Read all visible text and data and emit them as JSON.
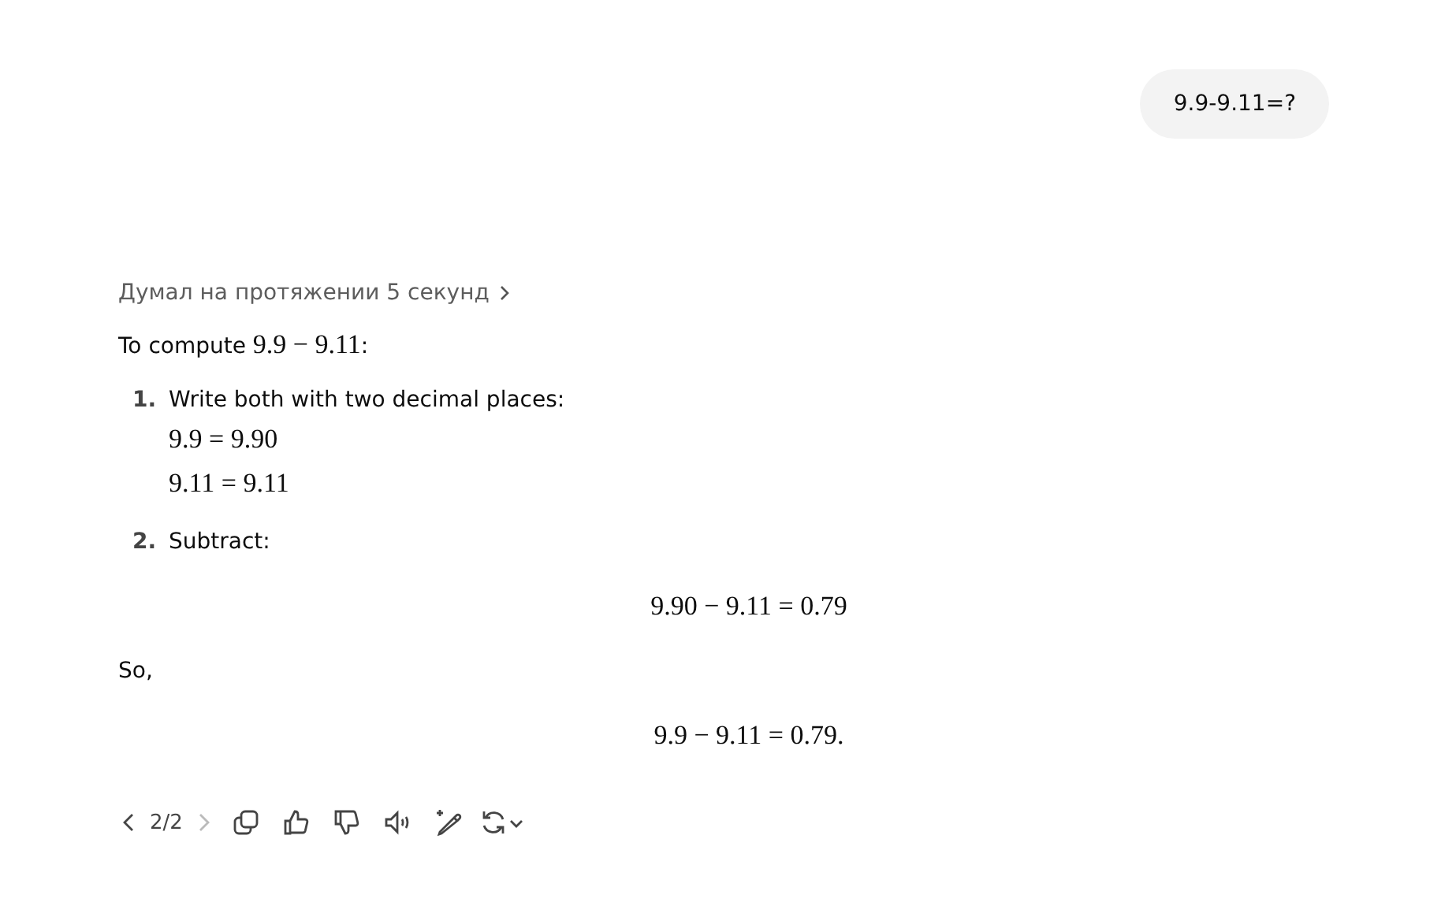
{
  "user_message": "9.9-9.11=?",
  "thought_toggle": "Думал на протяжении 5 секунд",
  "blocks": [
    {
      "kind": "paragraph",
      "text": "To compute ",
      "math": "9.9 − 9.11",
      "suffix": ":"
    },
    {
      "kind": "step",
      "number": "1.",
      "text": "Write both with two decimal places:",
      "equations": [
        "9.9 = 9.90",
        "9.11 = 9.11"
      ]
    },
    {
      "kind": "step",
      "number": "2.",
      "text": "Subtract:",
      "display": "9.90 − 9.11 = 0.79"
    },
    {
      "kind": "paragraph",
      "text": "So,"
    },
    {
      "kind": "display",
      "math": "9.9 − 9.11 = 0.79."
    }
  ],
  "pager": {
    "label": "2/2",
    "prev_disabled": false,
    "next_disabled": true
  },
  "actions": [
    {
      "kind": "copy"
    },
    {
      "kind": "like"
    },
    {
      "kind": "dislike"
    },
    {
      "kind": "read-aloud"
    },
    {
      "kind": "edit"
    },
    {
      "kind": "regenerate"
    }
  ]
}
